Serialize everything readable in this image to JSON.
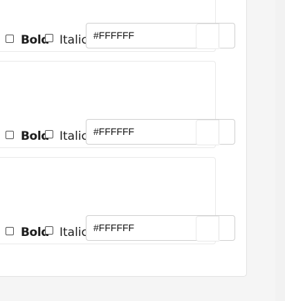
{
  "style_rows": [
    {
      "bold_label": "Bold",
      "italic_label": "Italic",
      "color_value": "#FFFFFF"
    },
    {
      "bold_label": "Bold",
      "italic_label": "Italic",
      "color_value": "#FFFFFF"
    },
    {
      "bold_label": "Bold",
      "italic_label": "Italic",
      "color_value": "#FFFFFF"
    }
  ],
  "colors": {
    "panel_background": "#ffffff",
    "page_background": "#f5f5f5",
    "border": "#cfcfcf",
    "text": "#1d1d1d"
  },
  "icons": {
    "checkbox": "checkbox-icon",
    "color_swatch": "color-swatch-icon"
  }
}
